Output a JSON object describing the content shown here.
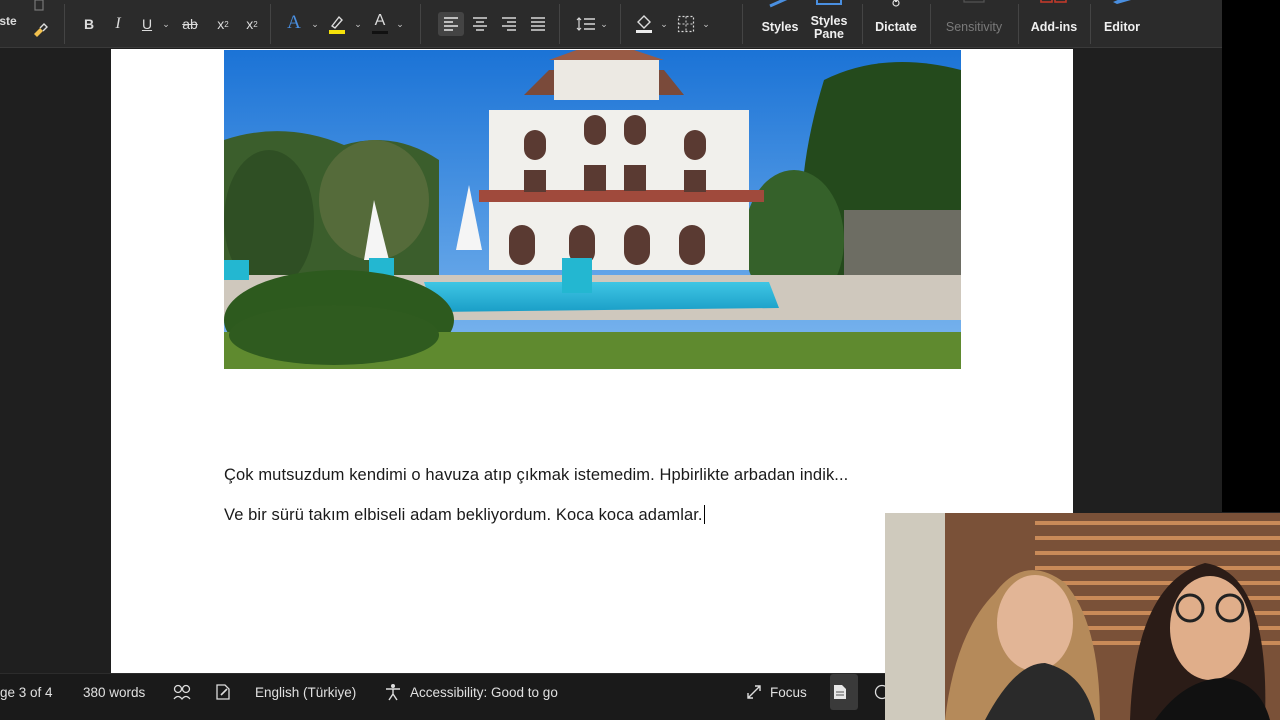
{
  "ribbon": {
    "paste_label": "ste",
    "bold": "B",
    "italic": "I",
    "underline": "U",
    "strikethrough": "ab",
    "subscript_base": "x",
    "subscript_mark": "2",
    "superscript_base": "x",
    "superscript_mark": "2",
    "text_effects": "A",
    "font_color": "A",
    "highlight_color": "#f5e10a",
    "font_underline_color": "#1a1a1a",
    "styles_label": "Styles",
    "styles_pane_label_1": "Styles",
    "styles_pane_label_2": "Pane",
    "dictate_label": "Dictate",
    "sensitivity_label": "Sensitivity",
    "addins_label": "Add-ins",
    "editor_label": "Editor"
  },
  "document": {
    "paragraphs": [
      "Çok mutsuzdum kendimi o havuza atıp çıkmak istemedim. Hpbirlikte arbadan indik...",
      "Ve bir sürü takım elbiseli adam bekliyordum. Koca koca adamlar."
    ],
    "image_icon": "villa-photo"
  },
  "status": {
    "page": "ge 3 of 4",
    "words": "380 words",
    "language": "English (Türkiye)",
    "accessibility": "Accessibility: Good to go",
    "focus": "Focus"
  },
  "colors": {
    "ribbon_bg": "#2b2b2b",
    "page_bg": "#ffffff",
    "app_bg": "#1f1f1f",
    "accent_blue": "#4a8fe0",
    "addins_red": "#c0392b"
  }
}
